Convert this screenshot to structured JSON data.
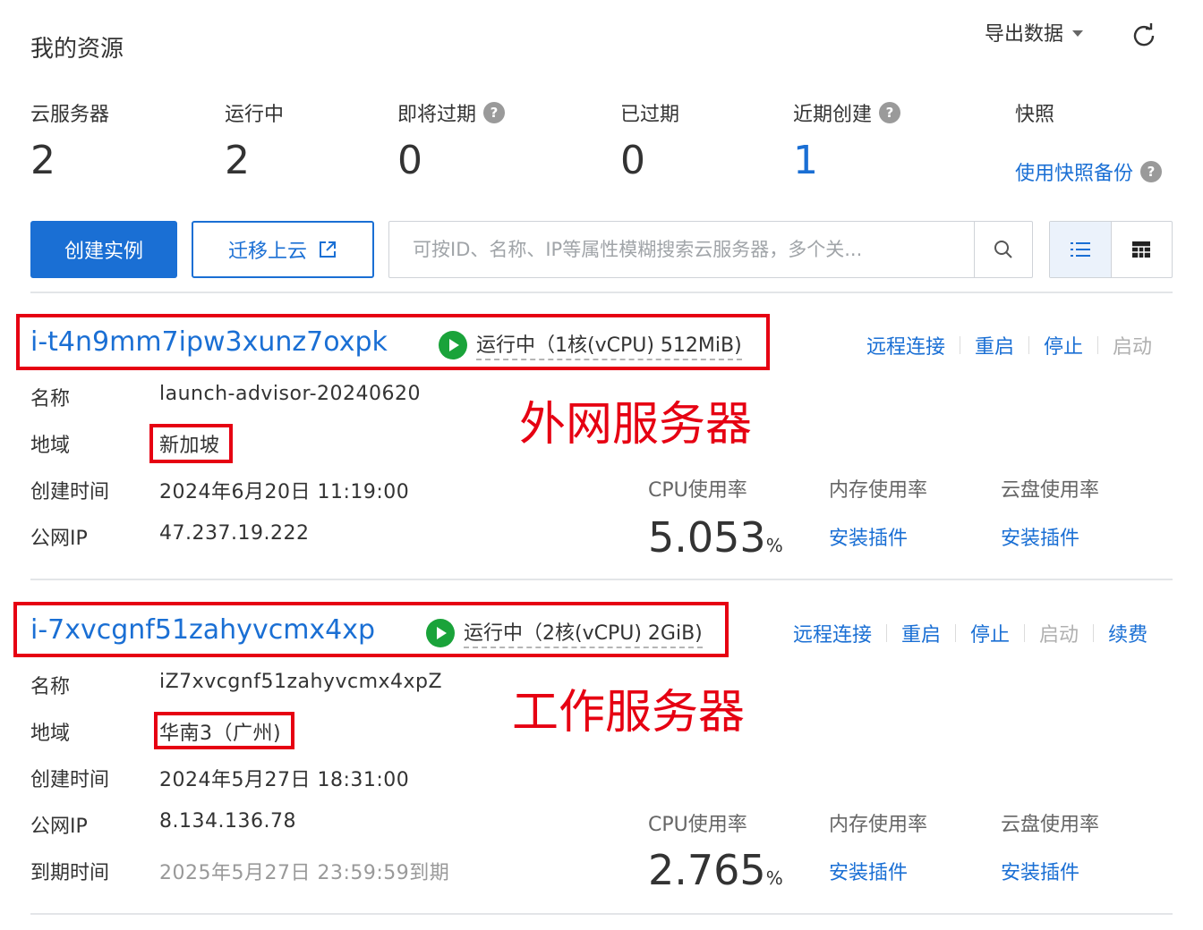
{
  "header": {
    "title": "我的资源",
    "export_label": "导出数据"
  },
  "stats": {
    "servers": {
      "label": "云服务器",
      "value": "2"
    },
    "running": {
      "label": "运行中",
      "value": "2"
    },
    "expiring": {
      "label": "即将过期",
      "value": "0"
    },
    "expired": {
      "label": "已过期",
      "value": "0"
    },
    "recent": {
      "label": "近期创建",
      "value": "1"
    },
    "snapshot": {
      "label": "快照",
      "link": "使用快照备份"
    },
    "help_glyph": "?"
  },
  "toolbar": {
    "create_label": "创建实例",
    "migrate_label": "迁移上云",
    "search_placeholder": "可按ID、名称、IP等属性模糊搜索云服务器，多个关..."
  },
  "field_labels": {
    "name": "名称",
    "region": "地域",
    "created": "创建时间",
    "public_ip": "公网IP",
    "expire": "到期时间"
  },
  "metric_labels": {
    "cpu": "CPU使用率",
    "mem": "内存使用率",
    "disk": "云盘使用率",
    "install_plugin": "安装插件",
    "unit": "%"
  },
  "action_labels": {
    "remote": "远程连接",
    "reboot": "重启",
    "stop": "停止",
    "start": "启动",
    "renew": "续费"
  },
  "instances": [
    {
      "id": "i-t4n9mm7ipw3xunz7oxpk",
      "status": "运行中（1核(vCPU) 512MiB)",
      "name": "launch-advisor-20240620",
      "region": "新加坡",
      "created": "2024年6月20日 11:19:00",
      "public_ip": "47.237.19.222",
      "cpu": "5.053",
      "annotation": "外网服务器"
    },
    {
      "id": "i-7xvcgnf51zahyvcmx4xp",
      "status": "运行中（2核(vCPU) 2GiB)",
      "name": "iZ7xvcgnf51zahyvcmx4xpZ",
      "region": "华南3（广州)",
      "created": "2024年5月27日 18:31:00",
      "public_ip": "8.134.136.78",
      "expire": "2025年5月27日 23:59:59到期",
      "cpu": "2.765",
      "annotation": "工作服务器"
    }
  ]
}
